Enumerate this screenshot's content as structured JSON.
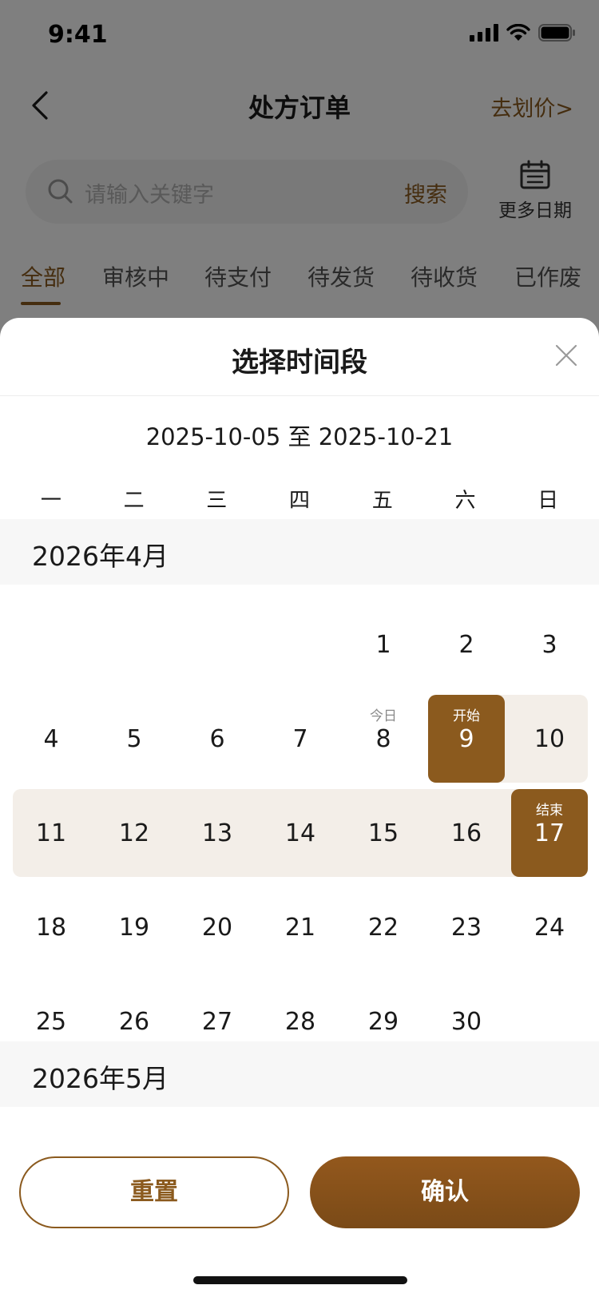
{
  "status_bar": {
    "time": "9:41"
  },
  "nav": {
    "title": "处方订单",
    "action": "去划价>"
  },
  "search": {
    "placeholder": "请输入关键字",
    "button": "搜索",
    "more_dates": "更多日期"
  },
  "tabs": [
    {
      "label": "全部",
      "active": true
    },
    {
      "label": "审核中",
      "active": false
    },
    {
      "label": "待支付",
      "active": false
    },
    {
      "label": "待发货",
      "active": false
    },
    {
      "label": "待收货",
      "active": false
    },
    {
      "label": "已作废",
      "active": false
    }
  ],
  "sheet": {
    "title": "选择时间段",
    "range_text": "2025-10-05 至 2025-10-21",
    "weekdays": [
      "一",
      "二",
      "三",
      "四",
      "五",
      "六",
      "日"
    ]
  },
  "calendar": {
    "months": [
      {
        "label": "2026年4月",
        "weeks": [
          [
            null,
            null,
            null,
            null,
            {
              "day": "1"
            },
            {
              "day": "2"
            },
            {
              "day": "3"
            }
          ],
          [
            {
              "day": "4"
            },
            {
              "day": "5"
            },
            {
              "day": "6"
            },
            {
              "day": "7"
            },
            {
              "day": "8",
              "note": "今日"
            },
            {
              "day": "9",
              "note": "开始",
              "state": "start"
            },
            {
              "day": "10",
              "state": "in-range"
            }
          ],
          [
            {
              "day": "11",
              "state": "in-range"
            },
            {
              "day": "12",
              "state": "in-range"
            },
            {
              "day": "13",
              "state": "in-range"
            },
            {
              "day": "14",
              "state": "in-range"
            },
            {
              "day": "15",
              "state": "in-range"
            },
            {
              "day": "16",
              "state": "in-range"
            },
            {
              "day": "17",
              "note": "结束",
              "state": "end"
            }
          ],
          [
            {
              "day": "18"
            },
            {
              "day": "19"
            },
            {
              "day": "20"
            },
            {
              "day": "21"
            },
            {
              "day": "22"
            },
            {
              "day": "23"
            },
            {
              "day": "24"
            }
          ],
          [
            {
              "day": "25"
            },
            {
              "day": "26"
            },
            {
              "day": "27"
            },
            {
              "day": "28"
            },
            {
              "day": "29"
            },
            {
              "day": "30"
            },
            null
          ]
        ]
      },
      {
        "label": "2026年5月",
        "weeks": []
      }
    ]
  },
  "footer": {
    "reset": "重置",
    "confirm": "确认"
  },
  "colors": {
    "accent": "#8b5a1e",
    "range_fill": "#f3eee8",
    "month_header_bg": "#f7f7f7"
  }
}
